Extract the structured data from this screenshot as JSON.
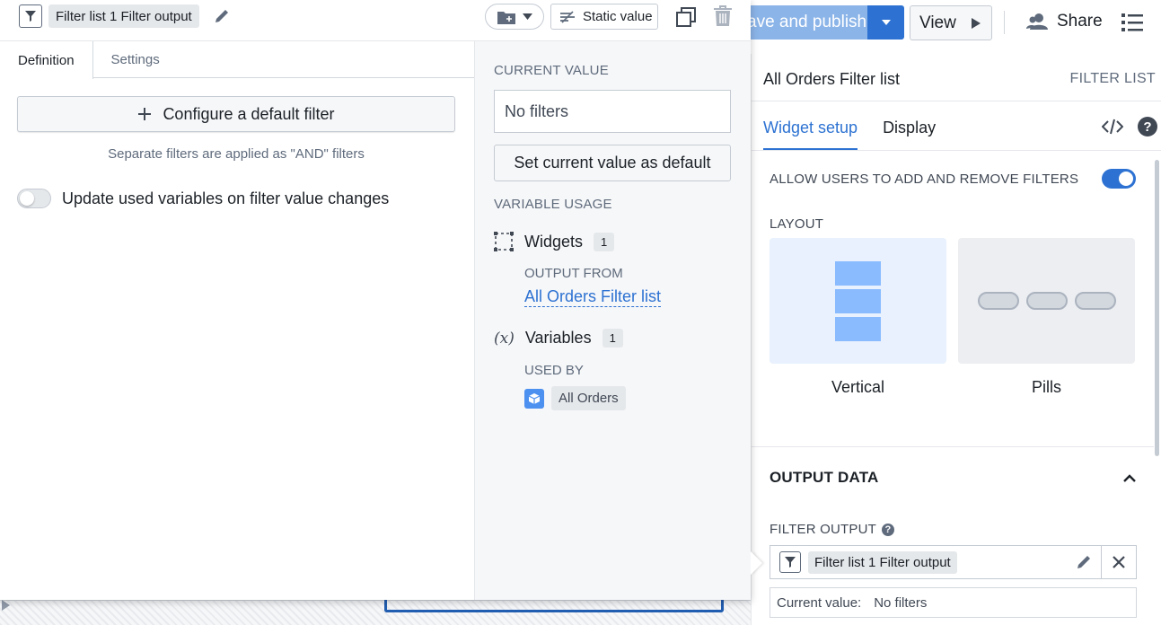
{
  "popover": {
    "header": {
      "filter_chip": "Filter list 1 Filter output",
      "static_value_label": "Static value"
    },
    "tabs": [
      "Definition",
      "Settings"
    ],
    "definition": {
      "configure_label": "Configure a default filter",
      "and_note": "Separate filters are applied as \"AND\" filters",
      "update_toggle_label": "Update used variables on filter value changes"
    },
    "right": {
      "current_value_label": "CURRENT VALUE",
      "current_value": "No filters",
      "set_default_label": "Set current value as default",
      "variable_usage_label": "VARIABLE USAGE",
      "widgets_label": "Widgets",
      "widgets_count": "1",
      "output_from_label": "OUTPUT FROM",
      "output_from_link": "All Orders Filter list",
      "variables_label": "Variables",
      "variables_count": "1",
      "used_by_label": "USED BY",
      "used_by_item": "All Orders"
    }
  },
  "topbar": {
    "publish_label": "ave and publish",
    "view_label": "View",
    "share_label": "Share"
  },
  "right_panel": {
    "title": "All Orders Filter list",
    "kind": "FILTER LIST",
    "tabs": [
      "Widget setup",
      "Display"
    ],
    "allow_label": "ALLOW USERS TO ADD AND REMOVE FILTERS",
    "layout_label": "LAYOUT",
    "layout_options": [
      "Vertical",
      "Pills"
    ],
    "output_data_label": "OUTPUT DATA",
    "filter_output_label": "FILTER OUTPUT",
    "filter_output_chip": "Filter list 1 Filter output",
    "current_value_label": "Current value:",
    "current_value": "No filters"
  },
  "colors": {
    "accent": "#2d72d2",
    "publish_disabled": "#8bb4e8",
    "layout_selected_bg": "#e8f1fd"
  }
}
